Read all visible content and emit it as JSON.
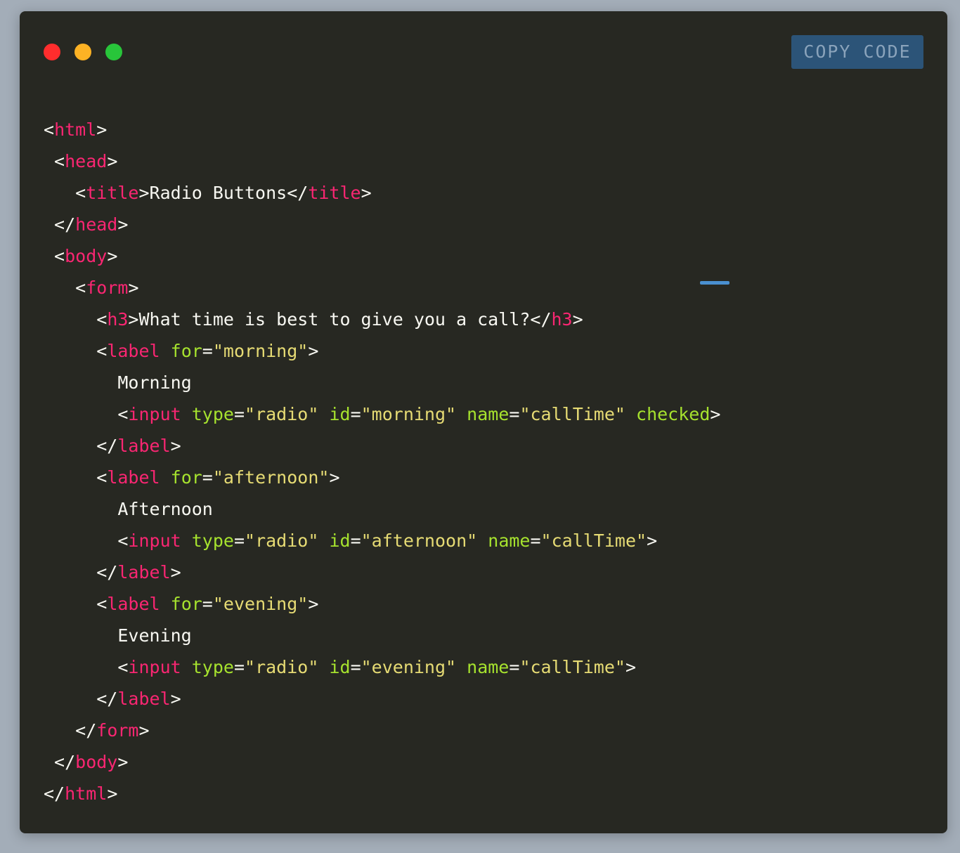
{
  "toolbar": {
    "copy_label": "COPY CODE"
  },
  "colors": {
    "background": "#272822",
    "tag": "#f92672",
    "attribute": "#a6e22e",
    "string": "#e6db74",
    "text": "#f8f8f2",
    "button_bg": "#2c5478",
    "dot_red": "#ff2d2d",
    "dot_yellow": "#fdb224",
    "dot_green": "#28c53a"
  },
  "code": {
    "lines": [
      [
        {
          "c": "p",
          "t": "<"
        },
        {
          "c": "t",
          "t": "html"
        },
        {
          "c": "p",
          "t": ">"
        }
      ],
      [
        {
          "c": "p",
          "t": " <"
        },
        {
          "c": "t",
          "t": "head"
        },
        {
          "c": "p",
          "t": ">"
        }
      ],
      [
        {
          "c": "p",
          "t": "   <"
        },
        {
          "c": "t",
          "t": "title"
        },
        {
          "c": "p",
          "t": ">"
        },
        {
          "c": "x",
          "t": "Radio Buttons"
        },
        {
          "c": "p",
          "t": "</"
        },
        {
          "c": "t",
          "t": "title"
        },
        {
          "c": "p",
          "t": ">"
        }
      ],
      [
        {
          "c": "p",
          "t": " </"
        },
        {
          "c": "t",
          "t": "head"
        },
        {
          "c": "p",
          "t": ">"
        }
      ],
      [
        {
          "c": "p",
          "t": " <"
        },
        {
          "c": "t",
          "t": "body"
        },
        {
          "c": "p",
          "t": ">"
        }
      ],
      [
        {
          "c": "p",
          "t": "   <"
        },
        {
          "c": "t",
          "t": "form"
        },
        {
          "c": "p",
          "t": ">"
        }
      ],
      [
        {
          "c": "p",
          "t": "     <"
        },
        {
          "c": "t",
          "t": "h3"
        },
        {
          "c": "p",
          "t": ">"
        },
        {
          "c": "x",
          "t": "What time is best to give you a call?"
        },
        {
          "c": "p",
          "t": "</"
        },
        {
          "c": "t",
          "t": "h3"
        },
        {
          "c": "p",
          "t": ">"
        }
      ],
      [
        {
          "c": "p",
          "t": "     <"
        },
        {
          "c": "t",
          "t": "label"
        },
        {
          "c": "p",
          "t": " "
        },
        {
          "c": "a",
          "t": "for"
        },
        {
          "c": "p",
          "t": "="
        },
        {
          "c": "s",
          "t": "\"morning\""
        },
        {
          "c": "p",
          "t": ">"
        }
      ],
      [
        {
          "c": "x",
          "t": "       Morning"
        }
      ],
      [
        {
          "c": "p",
          "t": "       <"
        },
        {
          "c": "t",
          "t": "input"
        },
        {
          "c": "p",
          "t": " "
        },
        {
          "c": "a",
          "t": "type"
        },
        {
          "c": "p",
          "t": "="
        },
        {
          "c": "s",
          "t": "\"radio\""
        },
        {
          "c": "p",
          "t": " "
        },
        {
          "c": "a",
          "t": "id"
        },
        {
          "c": "p",
          "t": "="
        },
        {
          "c": "s",
          "t": "\"morning\""
        },
        {
          "c": "p",
          "t": " "
        },
        {
          "c": "a",
          "t": "name"
        },
        {
          "c": "p",
          "t": "="
        },
        {
          "c": "s",
          "t": "\"callTime\""
        },
        {
          "c": "p",
          "t": " "
        },
        {
          "c": "a",
          "t": "checked"
        },
        {
          "c": "p",
          "t": ">"
        }
      ],
      [
        {
          "c": "p",
          "t": "     </"
        },
        {
          "c": "t",
          "t": "label"
        },
        {
          "c": "p",
          "t": ">"
        }
      ],
      [
        {
          "c": "p",
          "t": "     <"
        },
        {
          "c": "t",
          "t": "label"
        },
        {
          "c": "p",
          "t": " "
        },
        {
          "c": "a",
          "t": "for"
        },
        {
          "c": "p",
          "t": "="
        },
        {
          "c": "s",
          "t": "\"afternoon\""
        },
        {
          "c": "p",
          "t": ">"
        }
      ],
      [
        {
          "c": "x",
          "t": "       Afternoon"
        }
      ],
      [
        {
          "c": "p",
          "t": "       <"
        },
        {
          "c": "t",
          "t": "input"
        },
        {
          "c": "p",
          "t": " "
        },
        {
          "c": "a",
          "t": "type"
        },
        {
          "c": "p",
          "t": "="
        },
        {
          "c": "s",
          "t": "\"radio\""
        },
        {
          "c": "p",
          "t": " "
        },
        {
          "c": "a",
          "t": "id"
        },
        {
          "c": "p",
          "t": "="
        },
        {
          "c": "s",
          "t": "\"afternoon\""
        },
        {
          "c": "p",
          "t": " "
        },
        {
          "c": "a",
          "t": "name"
        },
        {
          "c": "p",
          "t": "="
        },
        {
          "c": "s",
          "t": "\"callTime\""
        },
        {
          "c": "p",
          "t": ">"
        }
      ],
      [
        {
          "c": "p",
          "t": "     </"
        },
        {
          "c": "t",
          "t": "label"
        },
        {
          "c": "p",
          "t": ">"
        }
      ],
      [
        {
          "c": "p",
          "t": "     <"
        },
        {
          "c": "t",
          "t": "label"
        },
        {
          "c": "p",
          "t": " "
        },
        {
          "c": "a",
          "t": "for"
        },
        {
          "c": "p",
          "t": "="
        },
        {
          "c": "s",
          "t": "\"evening\""
        },
        {
          "c": "p",
          "t": ">"
        }
      ],
      [
        {
          "c": "x",
          "t": "       Evening"
        }
      ],
      [
        {
          "c": "p",
          "t": "       <"
        },
        {
          "c": "t",
          "t": "input"
        },
        {
          "c": "p",
          "t": " "
        },
        {
          "c": "a",
          "t": "type"
        },
        {
          "c": "p",
          "t": "="
        },
        {
          "c": "s",
          "t": "\"radio\""
        },
        {
          "c": "p",
          "t": " "
        },
        {
          "c": "a",
          "t": "id"
        },
        {
          "c": "p",
          "t": "="
        },
        {
          "c": "s",
          "t": "\"evening\""
        },
        {
          "c": "p",
          "t": " "
        },
        {
          "c": "a",
          "t": "name"
        },
        {
          "c": "p",
          "t": "="
        },
        {
          "c": "s",
          "t": "\"callTime\""
        },
        {
          "c": "p",
          "t": ">"
        }
      ],
      [
        {
          "c": "p",
          "t": "     </"
        },
        {
          "c": "t",
          "t": "label"
        },
        {
          "c": "p",
          "t": ">"
        }
      ],
      [
        {
          "c": "p",
          "t": "   </"
        },
        {
          "c": "t",
          "t": "form"
        },
        {
          "c": "p",
          "t": ">"
        }
      ],
      [
        {
          "c": "p",
          "t": " </"
        },
        {
          "c": "t",
          "t": "body"
        },
        {
          "c": "p",
          "t": ">"
        }
      ],
      [
        {
          "c": "p",
          "t": "</"
        },
        {
          "c": "t",
          "t": "html"
        },
        {
          "c": "p",
          "t": ">"
        }
      ]
    ]
  }
}
